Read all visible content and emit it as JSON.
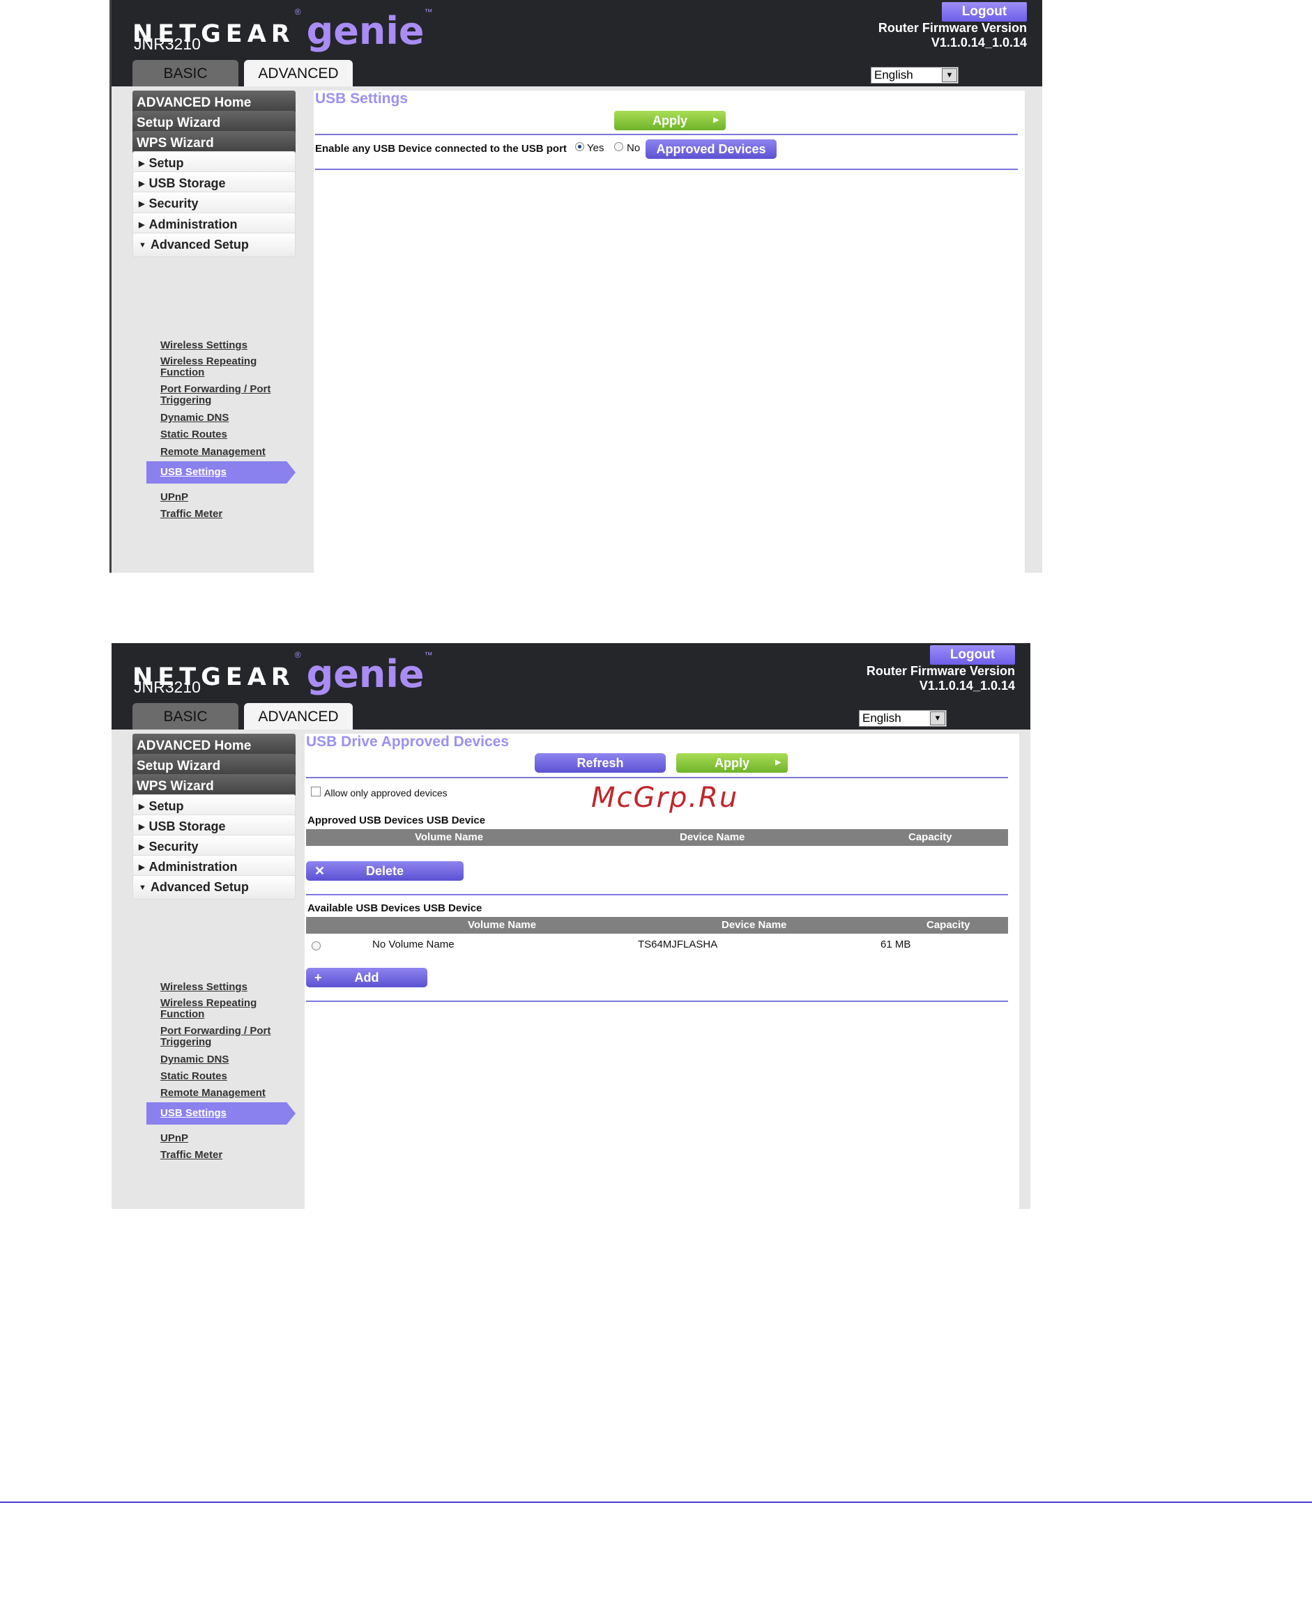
{
  "header": {
    "brand": "NETGEAR",
    "brand_mark": "®",
    "product": "genie",
    "product_mark": "™",
    "model": "JNR3210",
    "logout_label": "Logout",
    "firmware_label": "Router Firmware Version",
    "firmware_version": "V1.1.0.14_1.0.14",
    "language": "English",
    "tabs": {
      "basic": "BASIC",
      "advanced": "ADVANCED"
    }
  },
  "sidebar": {
    "primary": [
      "ADVANCED Home",
      "Setup Wizard",
      "WPS Wizard"
    ],
    "sections": [
      "Setup",
      "USB Storage",
      "Security",
      "Administration",
      "Advanced Setup"
    ],
    "advanced_setup_items": {
      "wireless_settings": "Wireless Settings",
      "wireless_repeating_1": "Wireless Repeating",
      "wireless_repeating_2": "Function",
      "port_forwarding_1": "Port Forwarding / Port",
      "port_forwarding_2": "Triggering",
      "dynamic_dns": "Dynamic DNS",
      "static_routes": "Static Routes",
      "remote_management": "Remote Management",
      "usb_settings": "USB Settings",
      "upnp": "UPnP",
      "traffic_meter": "Traffic Meter"
    }
  },
  "screen1": {
    "title": "USB Settings",
    "apply_label": "Apply",
    "enable_label": "Enable any USB Device connected to the USB port",
    "yes_label": "Yes",
    "no_label": "No",
    "selected": "Yes",
    "approved_devices_label": "Approved Devices"
  },
  "screen2": {
    "title": "USB Drive Approved Devices",
    "refresh_label": "Refresh",
    "apply_label": "Apply",
    "allow_only_label": "Allow only approved devices",
    "approved_heading": "Approved USB Devices USB Device",
    "available_heading": "Available USB Devices USB Device",
    "columns": [
      "Volume Name",
      "Device Name",
      "Capacity"
    ],
    "delete_label": "Delete",
    "add_label": "Add",
    "available_rows": [
      {
        "volume": "No Volume Name",
        "device": "TS64MJFLASHA",
        "capacity": "61 MB"
      }
    ]
  },
  "watermark": "McGrp.Ru",
  "colors": {
    "header_bg": "#24262a",
    "accent_purple": "#8a80ee",
    "apply_green": "#7fc236",
    "title_purple": "#9b91f5"
  }
}
